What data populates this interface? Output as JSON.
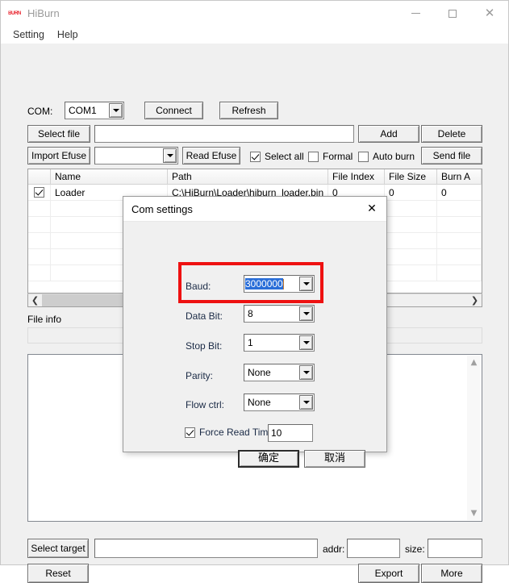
{
  "window": {
    "title": "HiBurn",
    "icon_label": "BURN",
    "controls": {
      "minimize": "minimize-icon",
      "maximize": "maximize-icon",
      "close": "close-icon"
    }
  },
  "menubar": {
    "items": [
      {
        "label": "Setting"
      },
      {
        "label": "Help"
      }
    ]
  },
  "toolbar": {
    "com_label": "COM:",
    "com_value": "COM1",
    "connect_label": "Connect",
    "refresh_label": "Refresh",
    "select_file_label": "Select file",
    "file_path_value": "",
    "add_label": "Add",
    "delete_label": "Delete",
    "import_efuse_label": "Import Efuse",
    "efuse_combo_value": "",
    "read_efuse_label": "Read Efuse",
    "select_all_label": "Select all",
    "select_all_checked": true,
    "formal_label": "Formal",
    "formal_checked": false,
    "auto_burn_label": "Auto burn",
    "auto_burn_checked": false,
    "send_file_label": "Send file"
  },
  "file_list": {
    "columns": [
      {
        "label": ""
      },
      {
        "label": "Name"
      },
      {
        "label": "Path"
      },
      {
        "label": "File Index"
      },
      {
        "label": "File Size"
      },
      {
        "label": "Burn A"
      }
    ],
    "rows": [
      {
        "checked": true,
        "name": "Loader",
        "path": "C:\\HiBurn\\Loader\\hiburn_loader.bin",
        "file_index": "0",
        "file_size": "0",
        "burn_addr": "0"
      }
    ]
  },
  "file_info": {
    "label": "File info",
    "value": ""
  },
  "log": {
    "value": ""
  },
  "bottom": {
    "select_target_label": "Select target",
    "target_value": "",
    "addr_label": "addr:",
    "addr_value": "",
    "size_label": "size:",
    "size_value": "",
    "reset_label": "Reset",
    "export_label": "Export",
    "more_label": "More"
  },
  "dialog": {
    "title": "Com settings",
    "close_icon": "close-icon",
    "fields": [
      {
        "label": "Baud:",
        "value": "3000000",
        "selected": true
      },
      {
        "label": "Data Bit:",
        "value": "8",
        "selected": false
      },
      {
        "label": "Stop Bit:",
        "value": "1",
        "selected": false
      },
      {
        "label": "Parity:",
        "value": "None",
        "selected": false
      },
      {
        "label": "Flow ctrl:",
        "value": "None",
        "selected": false
      }
    ],
    "force_read_time_label": "Force Read Time",
    "force_read_time_checked": true,
    "force_read_time_value": "10",
    "ok_label": "确定",
    "cancel_label": "取消",
    "highlight_color": "#ee1111",
    "selection_color": "#2a6ed8"
  }
}
